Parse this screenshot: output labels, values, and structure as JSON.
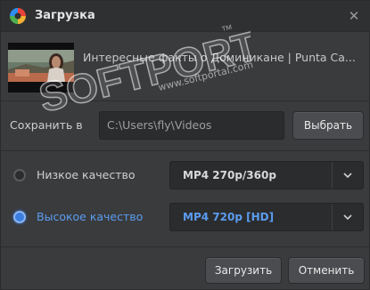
{
  "window": {
    "title": "Загрузка",
    "close_label": "✕",
    "app_icon": "app-logo-icon"
  },
  "video": {
    "title": "Интересные факты о Доминикане | Punta Ca..."
  },
  "save": {
    "label": "Сохранить в",
    "path": "C:\\Users\\fly\\Videos",
    "browse_label": "Выбрать"
  },
  "quality": {
    "low": {
      "label": "Низкое качество",
      "selected": false,
      "format": "MP4 270p/360p"
    },
    "high": {
      "label": "Высокое качество",
      "selected": true,
      "format": "MP4 720p [HD]"
    }
  },
  "actions": {
    "download_label": "Загрузить",
    "cancel_label": "Отменить"
  },
  "watermark": {
    "brand": "SOFTPORTAL",
    "tm": "™",
    "url": "www.softportal.com"
  },
  "colors": {
    "background": "#3a3b3d",
    "titlebar": "#2f3032",
    "accent": "#5b9cf0",
    "input_bg": "#2b2c2e",
    "button_bg": "#4b4c4f"
  }
}
